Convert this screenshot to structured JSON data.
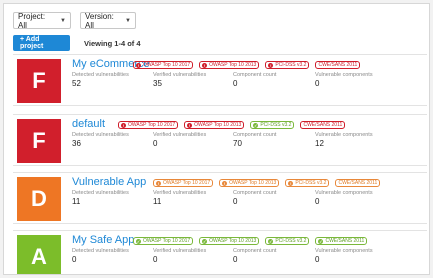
{
  "filters": {
    "project": "Project: All",
    "version": "Version: All"
  },
  "toolbar": {
    "add_label": "+ Add project",
    "viewing": "Viewing 1-4 of 4"
  },
  "labels": {
    "detected": "Detected vulnerabilities",
    "verified": "Verified vulnerabilities",
    "components": "Component count",
    "vulnerable": "Vulnerable components"
  },
  "colors": {
    "accent": "#1e88d6",
    "grade_F": "#d11f2c",
    "grade_D": "#ee7624",
    "grade_A": "#7cbd2a"
  },
  "apps": [
    {
      "grade": "F",
      "grade_color": "#d11f2c",
      "name": "My eCommerce",
      "badges": [
        {
          "text": "OWASP Top 10 2017",
          "style": "red",
          "icon": "!"
        },
        {
          "text": "OWASP Top 10 2013",
          "style": "red",
          "icon": "!"
        },
        {
          "text": "PCI-DSS v3.2",
          "style": "red",
          "icon": "!"
        },
        {
          "text": "CWE/SANS 2011",
          "style": "plain-red",
          "icon": ""
        }
      ],
      "detected": "52",
      "verified": "35",
      "components": "0",
      "vulnerable": "0"
    },
    {
      "grade": "F",
      "grade_color": "#d11f2c",
      "name": "default",
      "badges": [
        {
          "text": "OWASP Top 10 2017",
          "style": "red",
          "icon": "!"
        },
        {
          "text": "OWASP Top 10 2013",
          "style": "red",
          "icon": "!"
        },
        {
          "text": "PCI-DSS v3.2",
          "style": "green",
          "icon": "✓"
        },
        {
          "text": "CWE/SANS 2011",
          "style": "plain-red",
          "icon": ""
        }
      ],
      "detected": "36",
      "verified": "0",
      "components": "70",
      "vulnerable": "12"
    },
    {
      "grade": "D",
      "grade_color": "#ee7624",
      "name": "Vulnerable App",
      "badges": [
        {
          "text": "OWASP Top 10 2017",
          "style": "orange",
          "icon": "!"
        },
        {
          "text": "OWASP Top 10 2013",
          "style": "orange",
          "icon": "!"
        },
        {
          "text": "PCI-DSS v3.2",
          "style": "orange",
          "icon": "!"
        },
        {
          "text": "CWE/SANS 2011",
          "style": "plain-orange",
          "icon": ""
        }
      ],
      "detected": "11",
      "verified": "11",
      "components": "0",
      "vulnerable": "0"
    },
    {
      "grade": "A",
      "grade_color": "#7cbd2a",
      "name": "My Safe App",
      "badges": [
        {
          "text": "OWASP Top 10 2017",
          "style": "green",
          "icon": "✓"
        },
        {
          "text": "OWASP Top 10 2013",
          "style": "green",
          "icon": "✓"
        },
        {
          "text": "PCI-DSS v3.2",
          "style": "green",
          "icon": "✓"
        },
        {
          "text": "CWE/SANS 2011",
          "style": "green",
          "icon": "✓"
        }
      ],
      "detected": "0",
      "verified": "0",
      "components": "0",
      "vulnerable": "0"
    }
  ]
}
